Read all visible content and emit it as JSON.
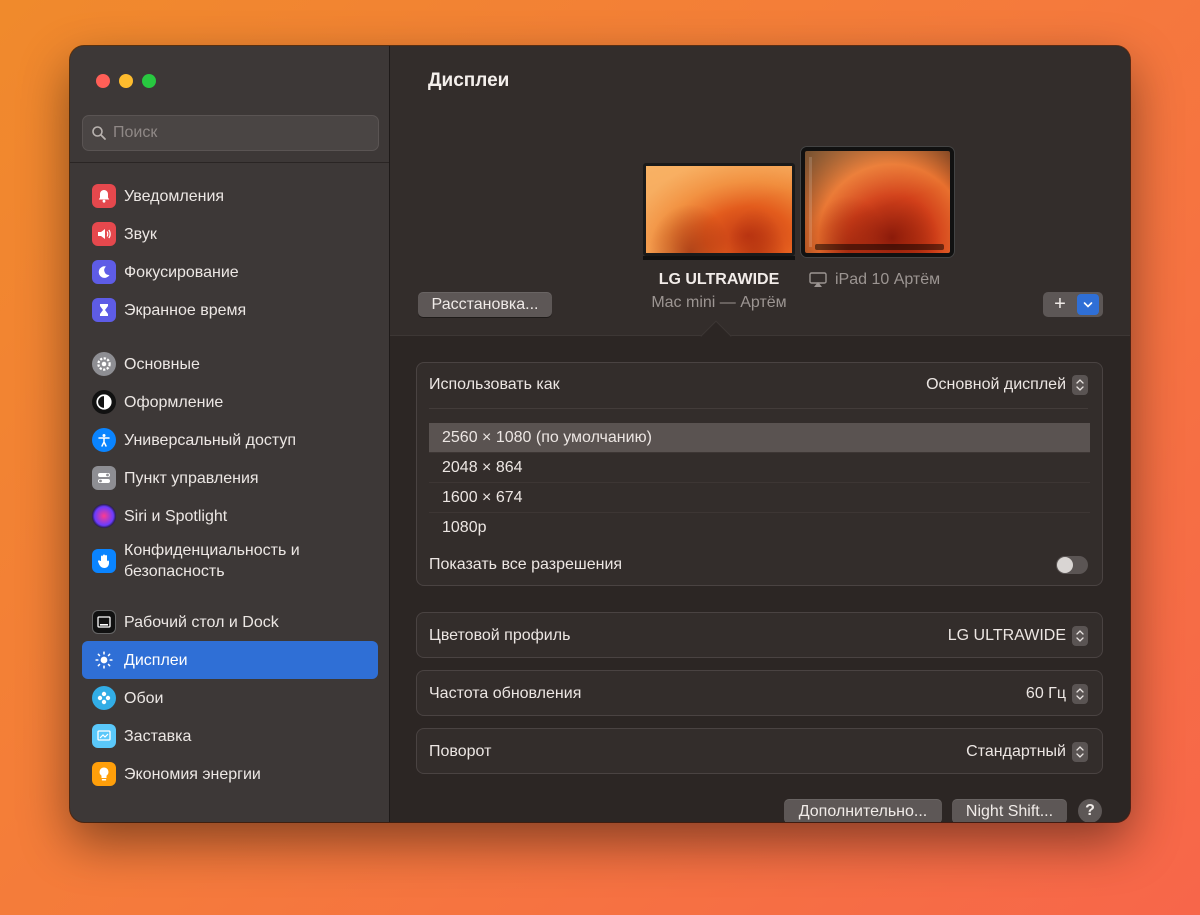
{
  "window": {
    "traffic_lights": [
      "close",
      "minimize",
      "zoom"
    ]
  },
  "search": {
    "placeholder": "Поиск"
  },
  "sidebar": {
    "items": [
      {
        "label": "Уведомления",
        "icon": "bell-icon",
        "color": "#e5484d"
      },
      {
        "label": "Звук",
        "icon": "speaker-icon",
        "color": "#e5484d"
      },
      {
        "label": "Фокусирование",
        "icon": "moon-icon",
        "color": "#5e5ce6"
      },
      {
        "label": "Экранное время",
        "icon": "hourglass-icon",
        "color": "#5e5ce6"
      },
      {
        "label": "Основные",
        "icon": "gear-icon",
        "color": "#8e8e93"
      },
      {
        "label": "Оформление",
        "icon": "appearance-icon",
        "color": "#1c1c1e"
      },
      {
        "label": "Универсальный доступ",
        "icon": "accessibility-icon",
        "color": "#0a84ff"
      },
      {
        "label": "Пункт управления",
        "icon": "toggles-icon",
        "color": "#8e8e93"
      },
      {
        "label": "Siri и Spotlight",
        "icon": "siri-icon",
        "color": "#1c1c1e"
      },
      {
        "label": "Конфиденциальность и безопасность",
        "icon": "hand-icon",
        "color": "#0a84ff"
      },
      {
        "label": "Рабочий стол и Dock",
        "icon": "dock-icon",
        "color": "#1c1c1e"
      },
      {
        "label": "Дисплеи",
        "icon": "sun-icon",
        "color": "#0a84ff",
        "active": true
      },
      {
        "label": "Обои",
        "icon": "flower-icon",
        "color": "#32ade6"
      },
      {
        "label": "Заставка",
        "icon": "screensaver-icon",
        "color": "#5ac8fa"
      },
      {
        "label": "Экономия энергии",
        "icon": "bulb-icon",
        "color": "#ff9f0a"
      }
    ]
  },
  "main": {
    "title": "Дисплеи",
    "displays": {
      "primary_name": "LG ULTRAWIDE",
      "primary_sub": "Mac mini — Артём",
      "ipad_name": "iPad 10 Артём"
    },
    "arrange_button": "Расстановка...",
    "add_button": "+",
    "use_as": {
      "label": "Использовать как",
      "value": "Основной дисплей"
    },
    "resolutions": [
      "2560 × 1080 (по умолчанию)",
      "2048 × 864",
      "1600 × 674",
      "1080p"
    ],
    "selected_resolution_index": 0,
    "show_all": {
      "label": "Показать все разрешения",
      "on": false
    },
    "color_profile": {
      "label": "Цветовой профиль",
      "value": "LG ULTRAWIDE"
    },
    "refresh_rate": {
      "label": "Частота обновления",
      "value": "60 Гц"
    },
    "rotation": {
      "label": "Поворот",
      "value": "Стандартный"
    },
    "buttons": {
      "advanced": "Дополнительно...",
      "night_shift": "Night Shift...",
      "help": "?"
    }
  },
  "colors": {
    "accent": "#2f6fd6"
  }
}
